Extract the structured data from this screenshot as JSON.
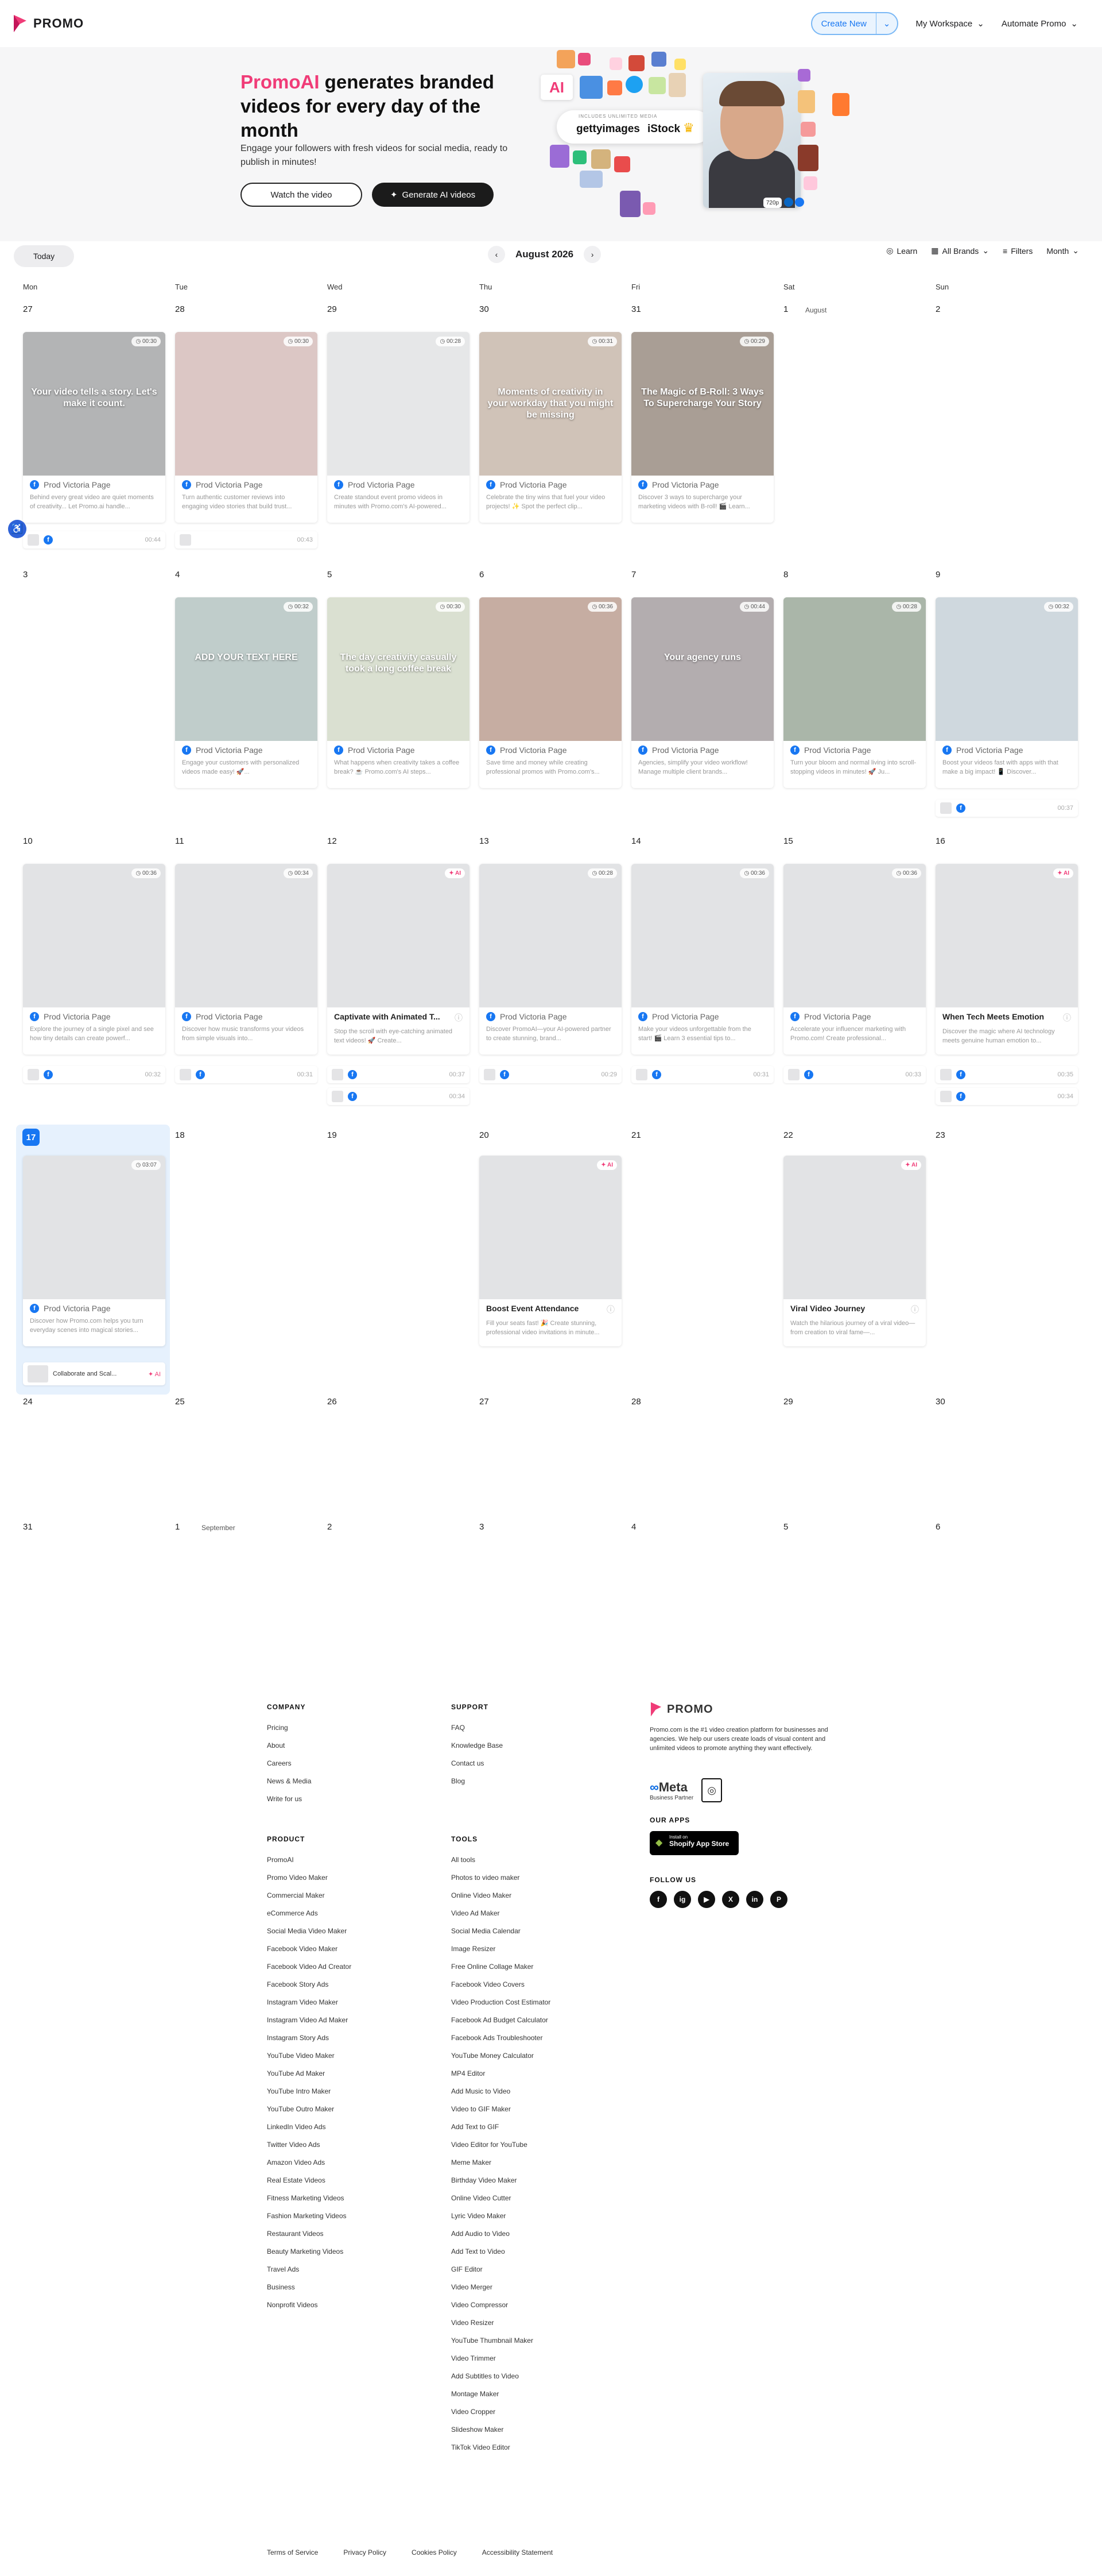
{
  "header": {
    "logo_text": "PROMO",
    "create_new": "Create New",
    "workspace": "My Workspace",
    "automate": "Automate Promo"
  },
  "hero": {
    "title_accent": "PromoAI",
    "title_rest": " generates branded videos for every day of the month",
    "subtitle": "Engage your followers with fresh videos for social media, ready to publish in minutes!",
    "watch_btn": "Watch the video",
    "generate_btn": "Generate AI videos",
    "getty_included": "INCLUDES UNLIMITED MEDIA",
    "getty": "gettyimages",
    "istock": "iStock",
    "ai_badge": "AI",
    "res_badge": "720p"
  },
  "toolbar": {
    "today": "Today",
    "month_label": "August 2026",
    "learn": "Learn",
    "brands": "All Brands",
    "filters": "Filters",
    "view": "Month"
  },
  "weekdays": [
    "Mon",
    "Tue",
    "Wed",
    "Thu",
    "Fri",
    "Sat",
    "Sun"
  ],
  "weeks": [
    [
      "27",
      "28",
      "29",
      "30",
      "31",
      "1",
      "2"
    ],
    [
      "3",
      "4",
      "5",
      "6",
      "7",
      "8",
      "9"
    ],
    [
      "10",
      "11",
      "12",
      "13",
      "14",
      "15",
      "16"
    ],
    [
      "17",
      "18",
      "19",
      "20",
      "21",
      "22",
      "23"
    ],
    [
      "24",
      "25",
      "26",
      "27",
      "28",
      "29",
      "30"
    ],
    [
      "31",
      "1",
      "2",
      "3",
      "4",
      "5",
      "6"
    ]
  ],
  "month_labels": {
    "august": "August",
    "september": "September"
  },
  "page_name": "Prod Victoria Page",
  "cards": [
    {
      "dur": "00:30",
      "desc": "Behind every great video are quiet moments of creativity... Let Promo.ai handle...",
      "thumb_text": "Your video tells a story. Let's make it count.",
      "bg": "#8a8c8e",
      "mini": "00:44"
    },
    {
      "dur": "00:30",
      "desc": "Turn authentic customer reviews into engaging video stories that build trust...",
      "thumb_text": "",
      "bg": "#c9a9a6",
      "mini": "00:43"
    },
    {
      "dur": "00:28",
      "desc": "Create standout event promo videos in minutes with Promo.com's AI-powered...",
      "thumb_text": "",
      "bg": "#d9dadc",
      "mini": ""
    },
    {
      "dur": "00:31",
      "desc": "Celebrate the tiny wins that fuel your video projects! ✨ Spot the perfect clip...",
      "thumb_text": "Moments of creativity in your workday that you might be missing",
      "bg": "#b7a393",
      "mini": ""
    },
    {
      "dur": "00:29",
      "desc": "Discover 3 ways to supercharge your marketing videos with B-roll! 🎬 Learn...",
      "thumb_text": "The Magic of B-Roll: 3 Ways To Supercharge Your Story",
      "bg": "#7c6a5c",
      "mini": ""
    },
    {
      "dur": "00:32",
      "desc": "Engage your customers with personalized videos made easy! 🚀...",
      "thumb_text": "ADD YOUR TEXT HERE",
      "bg": "#9fb3b0",
      "mini": ""
    },
    {
      "dur": "00:30",
      "desc": "What happens when creativity takes a coffee break? ☕ Promo.com's AI steps...",
      "thumb_text": "The day creativity casually took a long coffee break",
      "bg": "#c7d0b9",
      "mini": ""
    },
    {
      "dur": "00:36",
      "desc": "Save time and money while creating professional promos with Promo.com's...",
      "thumb_text": "",
      "bg": "#a88170",
      "mini": ""
    },
    {
      "dur": "00:44",
      "desc": "Agencies, simplify your video workflow! Manage multiple client brands...",
      "thumb_text": "Your agency runs",
      "bg": "#8a8285",
      "mini": ""
    },
    {
      "dur": "00:28",
      "desc": "Turn your bloom and normal living into scroll-stopping videos in minutes! 🚀 Ju...",
      "thumb_text": "",
      "bg": "#7d8f7c",
      "mini": ""
    },
    {
      "dur": "00:32",
      "desc": "Boost your videos fast with apps with that make a big impact! 📱 Discover...",
      "thumb_text": "",
      "bg": "#b6c3cc",
      "mini": "00:37"
    },
    {
      "dur": "00:36",
      "desc": "Explore the journey of a single pixel and see how tiny details can create powerf...",
      "mini": "00:32"
    },
    {
      "dur": "00:34",
      "desc": "Discover how music transforms your videos from simple visuals into...",
      "mini": "00:31"
    },
    {
      "ai": "AI",
      "title": "Captivate with Animated T...",
      "desc": "Stop the scroll with eye-catching animated text videos! 🚀 Create...",
      "mini": "00:37",
      "mini2": "00:34"
    },
    {
      "dur": "00:28",
      "desc": "Discover PromoAI—your AI-powered partner to create stunning, brand...",
      "mini": "00:29"
    },
    {
      "dur": "00:36",
      "desc": "Make your videos unforgettable from the start! 🎬 Learn 3 essential tips to...",
      "mini": "00:31"
    },
    {
      "dur": "00:36",
      "desc": "Accelerate your influencer marketing with Promo.com! Create professional...",
      "mini": "00:33"
    },
    {
      "ai": "AI",
      "title": "When Tech Meets Emotion",
      "desc": "Discover the magic where AI technology meets genuine human emotion to...",
      "mini": "00:35",
      "mini2": "00:34"
    }
  ],
  "week4": {
    "selected_card": {
      "dur": "03:07",
      "desc": "Discover how Promo.com helps you turn everyday scenes into magical stories...",
      "mini": "Collaborate and Scal..."
    },
    "boost": {
      "ai": "AI",
      "title": "Boost Event Attendance",
      "desc": "Fill your seats fast! 🎉 Create stunning, professional video invitations in minute..."
    },
    "viral": {
      "ai": "AI",
      "title": "Viral Video Journey",
      "desc": "Watch the hilarious journey of a viral video—from creation to viral fame—..."
    }
  },
  "footer": {
    "company_h": "COMPANY",
    "company": [
      "Pricing",
      "About",
      "Careers",
      "News & Media",
      "Write for us"
    ],
    "support_h": "SUPPORT",
    "support": [
      "FAQ",
      "Knowledge Base",
      "Contact us",
      "Blog"
    ],
    "product_h": "PRODUCT",
    "product": [
      "PromoAI",
      "Promo Video Maker",
      "Commercial Maker",
      "eCommerce Ads",
      "Social Media Video Maker",
      "Facebook Video Maker",
      "Facebook Video Ad Creator",
      "Facebook Story Ads",
      "Instagram Video Maker",
      "Instagram Video Ad Maker",
      "Instagram Story Ads",
      "YouTube Video Maker",
      "YouTube Ad Maker",
      "YouTube Intro Maker",
      "YouTube Outro Maker",
      "LinkedIn Video Ads",
      "Twitter Video Ads",
      "Amazon Video Ads",
      "Real Estate Videos",
      "Fitness Marketing Videos",
      "Fashion Marketing Videos",
      "Restaurant Videos",
      "Beauty Marketing Videos",
      "Travel Ads",
      "Business",
      "Nonprofit Videos"
    ],
    "tools_h": "TOOLS",
    "tools": [
      "All tools",
      "Photos to video maker",
      "Online Video Maker",
      "Video Ad Maker",
      "Social Media Calendar",
      "Image Resizer",
      "Free Online Collage Maker",
      "Facebook Video Covers",
      "Video Production Cost Estimator",
      "Facebook Ad Budget Calculator",
      "Facebook Ads Troubleshooter",
      "YouTube Money Calculator",
      "MP4 Editor",
      "Add Music to Video",
      "Video to GIF Maker",
      "Add Text to GIF",
      "Video Editor for YouTube",
      "Meme Maker",
      "Birthday Video Maker",
      "Online Video Cutter",
      "Lyric Video Maker",
      "Add Audio to Video",
      "Add Text to Video",
      "GIF Editor",
      "Video Merger",
      "Video Compressor",
      "Video Resizer",
      "YouTube Thumbnail Maker",
      "Video Trimmer",
      "Add Subtitles to Video",
      "Montage Maker",
      "Video Cropper",
      "Slideshow Maker",
      "TikTok Video Editor"
    ],
    "brand": "PROMO",
    "about": "Promo.com is the #1 video creation platform for businesses and agencies. We help our users create loads of visual content and unlimited videos to promote anything they want effectively.",
    "meta": "Meta",
    "meta_sub": "Business Partner",
    "our_apps": "OUR APPS",
    "app_small": "Install on",
    "app_big": "Shopify App Store",
    "follow": "FOLLOW US",
    "social": [
      "f",
      "ig",
      "▶",
      "X",
      "in",
      "P"
    ],
    "bottom": [
      "Terms of Service",
      "Privacy Policy",
      "Cookies Policy",
      "Accessibility Statement"
    ]
  },
  "colors": {
    "accent": "#1877f2",
    "brand_pink": "#f03c78",
    "selected_bg": "#e6f1fd"
  }
}
